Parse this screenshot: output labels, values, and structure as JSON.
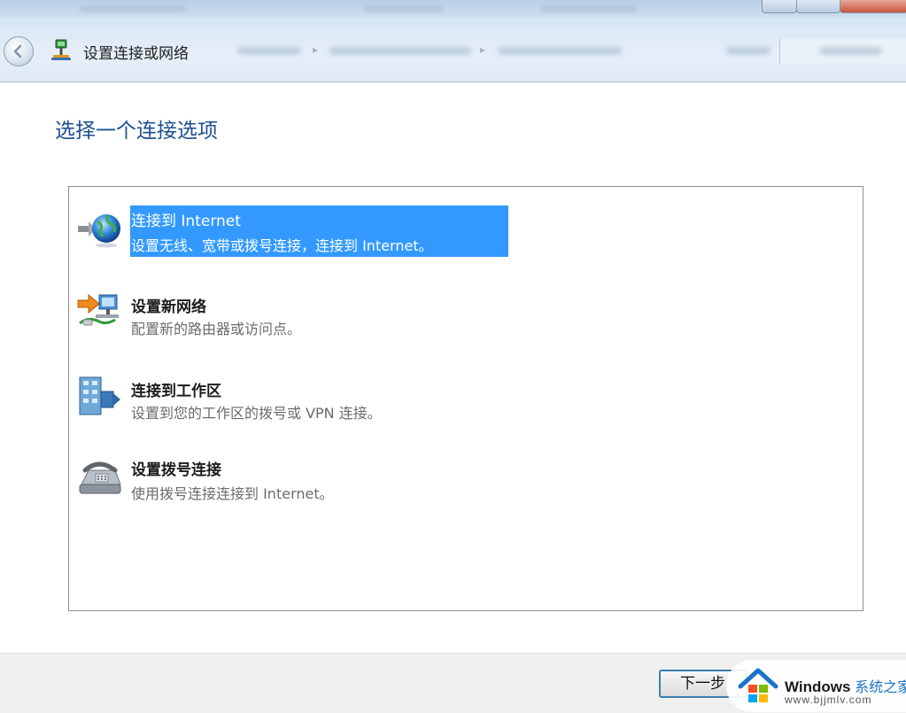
{
  "window": {
    "title": "设置连接或网络"
  },
  "heading": "选择一个连接选项",
  "options": [
    {
      "title": "连接到 Internet",
      "description": "设置无线、宽带或拨号连接，连接到 Internet。",
      "icon": "globe-network-icon",
      "selected": true
    },
    {
      "title": "设置新网络",
      "description": "配置新的路由器或访问点。",
      "icon": "new-network-router-icon",
      "selected": false
    },
    {
      "title": "连接到工作区",
      "description": "设置到您的工作区的拨号或 VPN 连接。",
      "icon": "workplace-vpn-icon",
      "selected": false
    },
    {
      "title": "设置拨号连接",
      "description": "使用拨号连接连接到 Internet。",
      "icon": "dialup-phone-icon",
      "selected": false
    }
  ],
  "footer": {
    "next_label": "下一步"
  },
  "watermark": {
    "brand": "Windows",
    "brand_cn": "系统之家",
    "url": "www.bjjmlv.com"
  },
  "colors": {
    "heading": "#1d4f91",
    "selection": "#3399ff",
    "button_border": "#3c7fb1"
  }
}
